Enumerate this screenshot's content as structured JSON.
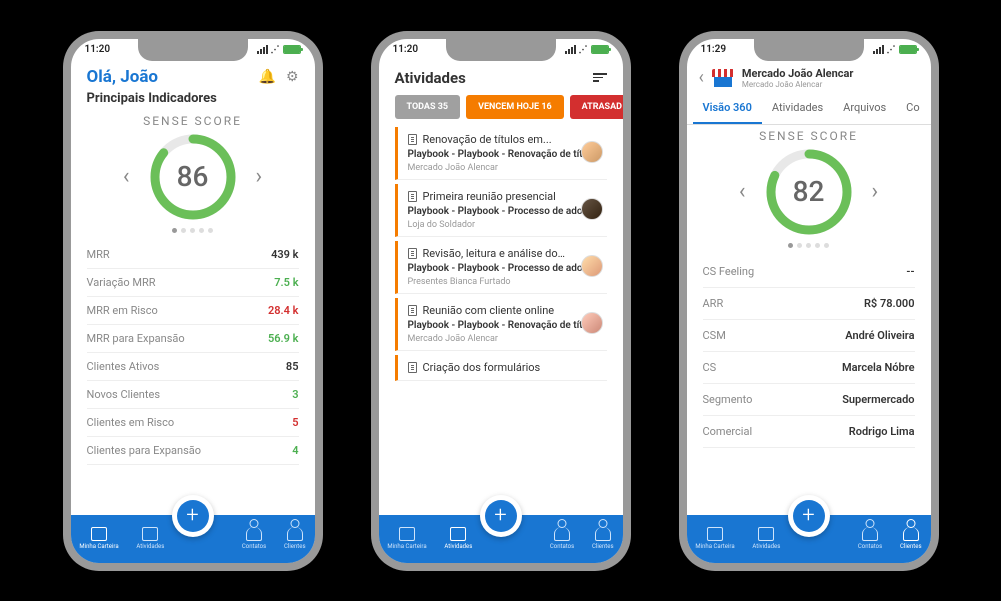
{
  "status": {
    "time1": "11:20",
    "time2": "11:20",
    "time3": "11:29"
  },
  "screen1": {
    "greeting": "Olá,  João",
    "subtitle": "Principais Indicadores",
    "score_title": "SENSE SCORE",
    "score": "86",
    "metrics": [
      {
        "label": "MRR",
        "value": "439 k",
        "cls": ""
      },
      {
        "label": "Variação MRR",
        "value": "7.5 k",
        "cls": "v-green"
      },
      {
        "label": "MRR em Risco",
        "value": "28.4 k",
        "cls": "v-red"
      },
      {
        "label": "MRR para Expansão",
        "value": "56.9 k",
        "cls": "v-green"
      },
      {
        "label": "Clientes Ativos",
        "value": "85",
        "cls": ""
      },
      {
        "label": "Novos Clientes",
        "value": "3",
        "cls": "v-green"
      },
      {
        "label": "Clientes em Risco",
        "value": "5",
        "cls": "v-red"
      },
      {
        "label": "Clientes para Expansão",
        "value": "4",
        "cls": "v-green"
      }
    ]
  },
  "screen2": {
    "title": "Atividades",
    "chips": [
      {
        "label": "TODAS 35",
        "cls": "gray"
      },
      {
        "label": "VENCEM HOJE 16",
        "cls": "orange"
      },
      {
        "label": "ATRASAD",
        "cls": "red"
      }
    ],
    "activities": [
      {
        "title": "Renovação de títulos em...",
        "sub": "Playbook - Playbook - Renovação de títulos",
        "client": "Mercado João Alencar",
        "av": ""
      },
      {
        "title": "Primeira reunião presencial",
        "sub": "Playbook - Playbook - Processo de adoção",
        "client": "Loja do Soldador",
        "av": "a2"
      },
      {
        "title": "Revisão, leitura e análise do…",
        "sub": "Playbook - Playbook - Processo de adoção",
        "client": "Presentes Bianca Furtado",
        "av": "a3"
      },
      {
        "title": "Reunião com cliente online",
        "sub": "Playbook - Playbook - Renovação de títulos",
        "client": "Mercado João Alencar",
        "av": "a4"
      },
      {
        "title": "Criação dos formulários",
        "sub": "",
        "client": "",
        "av": ""
      }
    ]
  },
  "screen3": {
    "store": "Mercado João Alencar",
    "store_sub": "Mercado João Alencar",
    "tabs": [
      "Visão 360",
      "Atividades",
      "Arquivos",
      "Co"
    ],
    "score_title": "SENSE SCORE",
    "score": "82",
    "fields": [
      {
        "label": "CS Feeling",
        "value": "--"
      },
      {
        "label": "ARR",
        "value": "R$ 78.000"
      },
      {
        "label": "CSM",
        "value": "André Oliveira"
      },
      {
        "label": "CS",
        "value": "Marcela Nóbre"
      },
      {
        "label": "Segmento",
        "value": "Supermercado"
      },
      {
        "label": "Comercial",
        "value": "Rodrigo Lima"
      }
    ]
  },
  "nav": {
    "items": [
      "Minha Carteira",
      "Atividades",
      "Clientes",
      "Contatos"
    ]
  }
}
